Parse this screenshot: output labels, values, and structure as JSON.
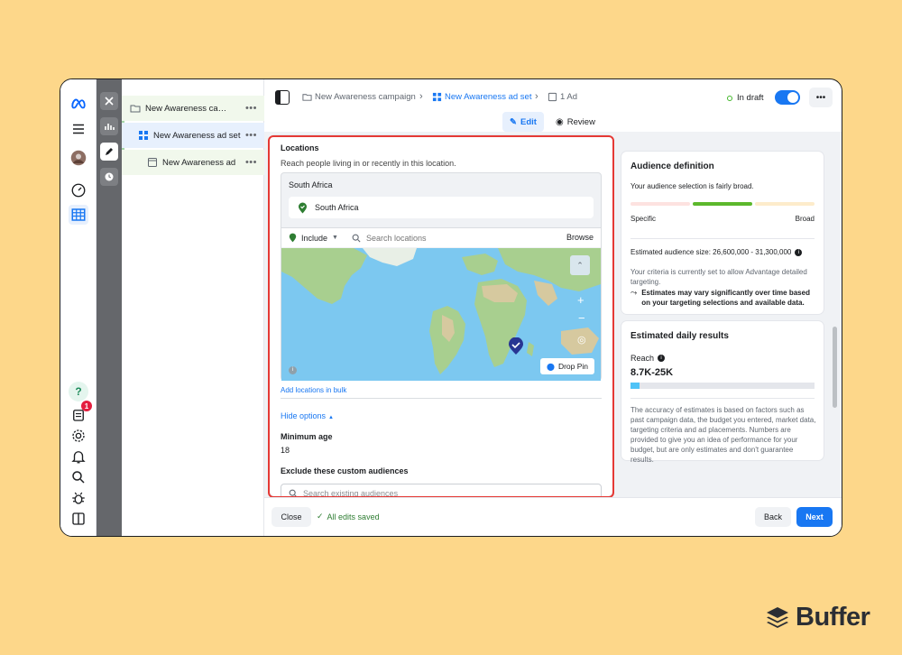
{
  "breadcrumbs": [
    "New Awareness campaign",
    "New Awareness ad set",
    "1 Ad"
  ],
  "status": "In draft",
  "tabs": {
    "edit": "Edit",
    "review": "Review"
  },
  "tree": [
    {
      "label": "New Awareness campaign"
    },
    {
      "label": "New Awareness ad set"
    },
    {
      "label": "New Awareness ad"
    }
  ],
  "rail": {
    "notification_count": "1"
  },
  "locations": {
    "title": "Locations",
    "subtitle": "Reach people living in or recently in this location.",
    "region_header": "South Africa",
    "selected": "South Africa",
    "include_label": "Include",
    "search_placeholder": "Search locations",
    "browse": "Browse",
    "drop_pin": "Drop Pin",
    "add_bulk": "Add locations in bulk",
    "hide_options": "Hide options",
    "min_age_label": "Minimum age",
    "min_age_value": "18",
    "exclude_label": "Exclude these custom audiences",
    "exclude_placeholder": "Search existing audiences"
  },
  "audience": {
    "title": "Audience definition",
    "summary": "Your audience selection is fairly broad.",
    "specific": "Specific",
    "broad": "Broad",
    "size": "Estimated audience size: 26,600,000 - 31,300,000",
    "criteria": "Your criteria is currently set to allow Advantage detailed targeting.",
    "note": "Estimates may vary significantly over time based on your targeting selections and available data."
  },
  "daily": {
    "title": "Estimated daily results",
    "reach_label": "Reach",
    "reach_value": "8.7K-25K",
    "reach_fill": 0.05,
    "disclaimer": "The accuracy of estimates is based on factors such as past campaign data, the budget you entered, market data, targeting criteria and ad placements. Numbers are provided to give you an idea of performance for your budget, but are only estimates and don't guarantee results."
  },
  "footer": {
    "close": "Close",
    "saved": "All edits saved",
    "back": "Back",
    "next": "Next"
  },
  "brand": {
    "name": "Buffer"
  },
  "colors": {
    "accent": "#1877f2",
    "annotation": "#e53935",
    "success": "#42b72a"
  }
}
